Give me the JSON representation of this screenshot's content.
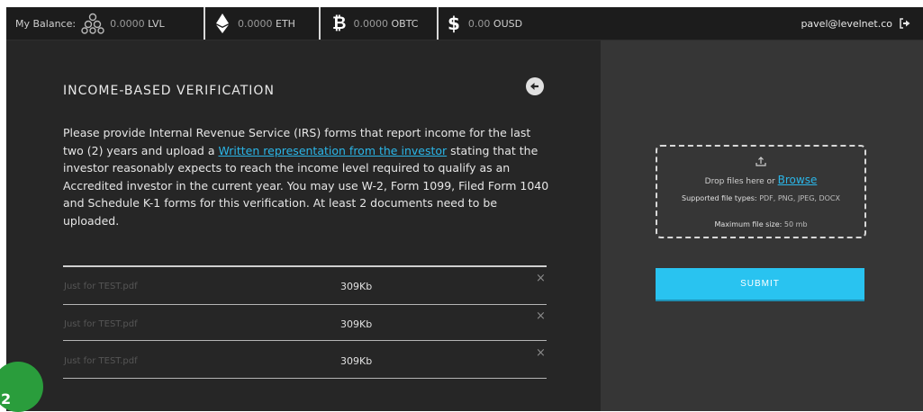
{
  "topbar": {
    "balance_label": "My Balance:",
    "balances": [
      {
        "amount": "0.0000",
        "unit": "LVL",
        "icon": "lvl-network-icon"
      },
      {
        "amount": "0.0000",
        "unit": "ETH",
        "icon": "ethereum-icon"
      },
      {
        "amount": "0.0000",
        "unit": "OBTC",
        "icon": "bitcoin-icon"
      },
      {
        "amount": "0.00",
        "unit": "OUSD",
        "icon": "dollar-icon"
      }
    ],
    "user_email": "pavel@levelnet.co",
    "logout_icon": "logout-icon"
  },
  "section": {
    "title": "INCOME-BASED VERIFICATION",
    "back_icon": "arrow-left-circle-icon",
    "desc_part1": "Please provide Internal Revenue Service (IRS) forms that report income for the last two (2) years and upload a ",
    "desc_link": "Written representation from the investor",
    "desc_part2": " stating that the investor reasonably expects to reach the income level required to qualify as an Accredited investor in the current year. You may use W-2, Form 1099, Filed Form 1040 and Schedule K-1 forms for this verification. At least 2 documents need to be uploaded."
  },
  "files": [
    {
      "name": "Just for TEST.pdf",
      "size": "309Kb",
      "remove": "×"
    },
    {
      "name": "Just for TEST.pdf",
      "size": "309Kb",
      "remove": "×"
    },
    {
      "name": "Just for TEST.pdf",
      "size": "309Kb",
      "remove": "×"
    }
  ],
  "upload": {
    "upload_icon": "upload-icon",
    "drop_text": "Drop files here or",
    "browse": "Browse",
    "types_label": "Supported file types:",
    "types_value": "PDF, PNG, JPEG, DOCX",
    "size_label": "Maximum file size:",
    "size_value": "50 mb",
    "submit": "SUBMIT"
  },
  "badge": {
    "number": "2"
  },
  "colors": {
    "accent": "#29c3f0",
    "link": "#2bb6e8",
    "badge": "#2a9d3c"
  }
}
